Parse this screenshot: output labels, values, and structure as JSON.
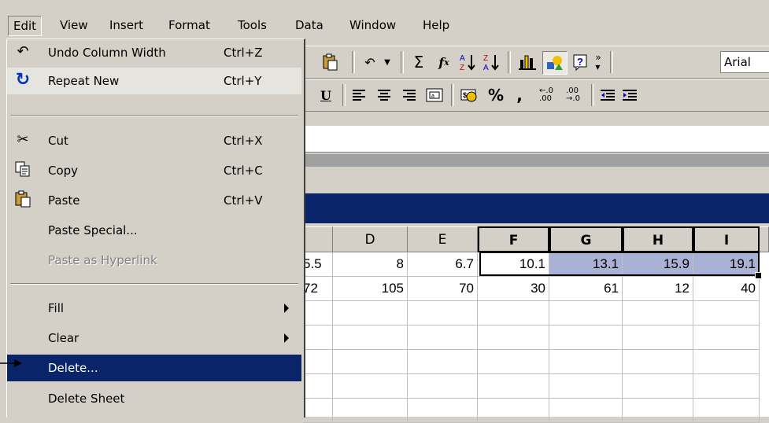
{
  "menubar": {
    "items": [
      {
        "label": "Edit",
        "underline": "E"
      },
      {
        "label": "View",
        "underline": "V"
      },
      {
        "label": "Insert",
        "underline": "I"
      },
      {
        "label": "Format",
        "underline": "o"
      },
      {
        "label": "Tools",
        "underline": "T"
      },
      {
        "label": "Data",
        "underline": "D"
      },
      {
        "label": "Window",
        "underline": "W"
      },
      {
        "label": "Help",
        "underline": "H"
      }
    ]
  },
  "edit_menu": {
    "items": [
      {
        "label": "Undo Column Width",
        "shortcut": "Ctrl+Z",
        "icon": "undo-icon"
      },
      {
        "label": "Repeat New",
        "shortcut": "Ctrl+Y",
        "icon": "repeat-icon"
      },
      {
        "label": "Cut",
        "shortcut": "Ctrl+X",
        "icon": "scissors-icon"
      },
      {
        "label": "Copy",
        "shortcut": "Ctrl+C",
        "icon": "copy-icon"
      },
      {
        "label": "Paste",
        "shortcut": "Ctrl+V",
        "icon": "paste-icon"
      },
      {
        "label": "Paste Special...",
        "shortcut": ""
      },
      {
        "label": "Paste as Hyperlink",
        "shortcut": "",
        "disabled": true
      },
      {
        "label": "Fill",
        "submenu": true
      },
      {
        "label": "Clear",
        "submenu": true
      },
      {
        "label": "Delete...",
        "highlighted": true
      },
      {
        "label": "Delete Sheet"
      }
    ]
  },
  "toolbar": {
    "font_name": "Arial",
    "icons": [
      "paste-icon",
      "undo-icon",
      "autosum-icon",
      "function-icon",
      "sort-ascending-icon",
      "sort-descending-icon",
      "chart-wizard-icon",
      "drawing-icon",
      "help-icon",
      "overflow-icon"
    ],
    "format_icons": [
      "underline-icon",
      "align-left-icon",
      "align-center-icon",
      "align-right-icon",
      "merge-center-icon",
      "currency-icon",
      "percent-icon",
      "comma-icon",
      "increase-decimal-icon",
      "decrease-decimal-icon",
      "decrease-indent-icon",
      "increase-indent-icon"
    ]
  },
  "grid": {
    "columns": [
      "",
      "D",
      "E",
      "F",
      "G",
      "H",
      "I"
    ],
    "row1": [
      "5.5",
      "8",
      "6.7",
      "10.1",
      "13.1",
      "15.9",
      "19.1"
    ],
    "row2": [
      "72",
      "105",
      "70",
      "30",
      "61",
      "12",
      "40"
    ]
  },
  "colors": {
    "menu_bg": "#d4d0c8",
    "highlight": "#0a246a",
    "selection_fill": "#a9b2d4"
  }
}
